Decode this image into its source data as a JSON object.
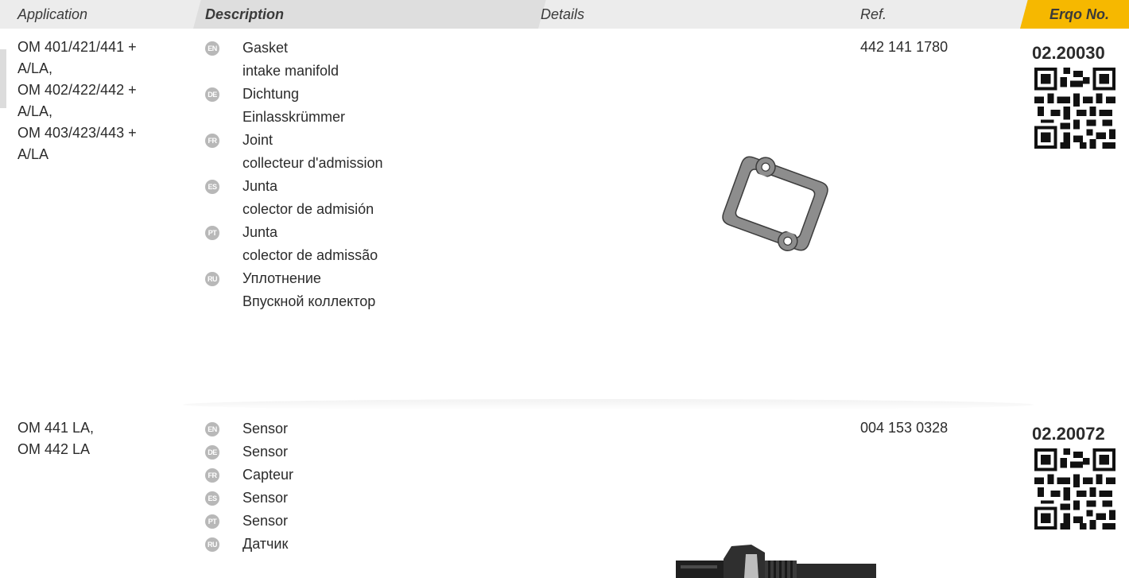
{
  "header": {
    "application": "Application",
    "description": "Description",
    "details": "Details",
    "ref": "Ref.",
    "erqo_no": "Erqo No."
  },
  "products": [
    {
      "application": [
        "OM 401/421/441 +",
        "A/LA,",
        "OM 402/422/442 +",
        "A/LA,",
        "OM 403/423/443 +",
        "A/LA"
      ],
      "descriptions": [
        {
          "lang": "EN",
          "name": "Gasket",
          "detail": "intake manifold"
        },
        {
          "lang": "DE",
          "name": "Dichtung",
          "detail": "Einlasskrümmer"
        },
        {
          "lang": "FR",
          "name": "Joint",
          "detail": "collecteur d'admission"
        },
        {
          "lang": "ES",
          "name": "Junta",
          "detail": "colector de admisión"
        },
        {
          "lang": "PT",
          "name": "Junta",
          "detail": "colector de admissão"
        },
        {
          "lang": "RU",
          "name": "Уплотнение",
          "detail": "Впускной коллектор"
        }
      ],
      "ref": "442 141 1780",
      "erqo_no": "02.20030",
      "image_icon": "gasket-image"
    },
    {
      "application": [
        "OM 441 LA,",
        "OM 442 LA"
      ],
      "descriptions": [
        {
          "lang": "EN",
          "name": "Sensor"
        },
        {
          "lang": "DE",
          "name": "Sensor"
        },
        {
          "lang": "FR",
          "name": "Capteur"
        },
        {
          "lang": "ES",
          "name": "Sensor"
        },
        {
          "lang": "PT",
          "name": "Sensor"
        },
        {
          "lang": "RU",
          "name": "Датчик"
        }
      ],
      "ref": "004 153 0328",
      "erqo_no": "02.20072",
      "image_icon": "sensor-image"
    }
  ],
  "colors": {
    "header_bg": "#ececec",
    "description_tab": "#dedede",
    "erqo_accent": "#f6b800",
    "badge": "#b8b8b8",
    "text": "#2b2b2b"
  }
}
